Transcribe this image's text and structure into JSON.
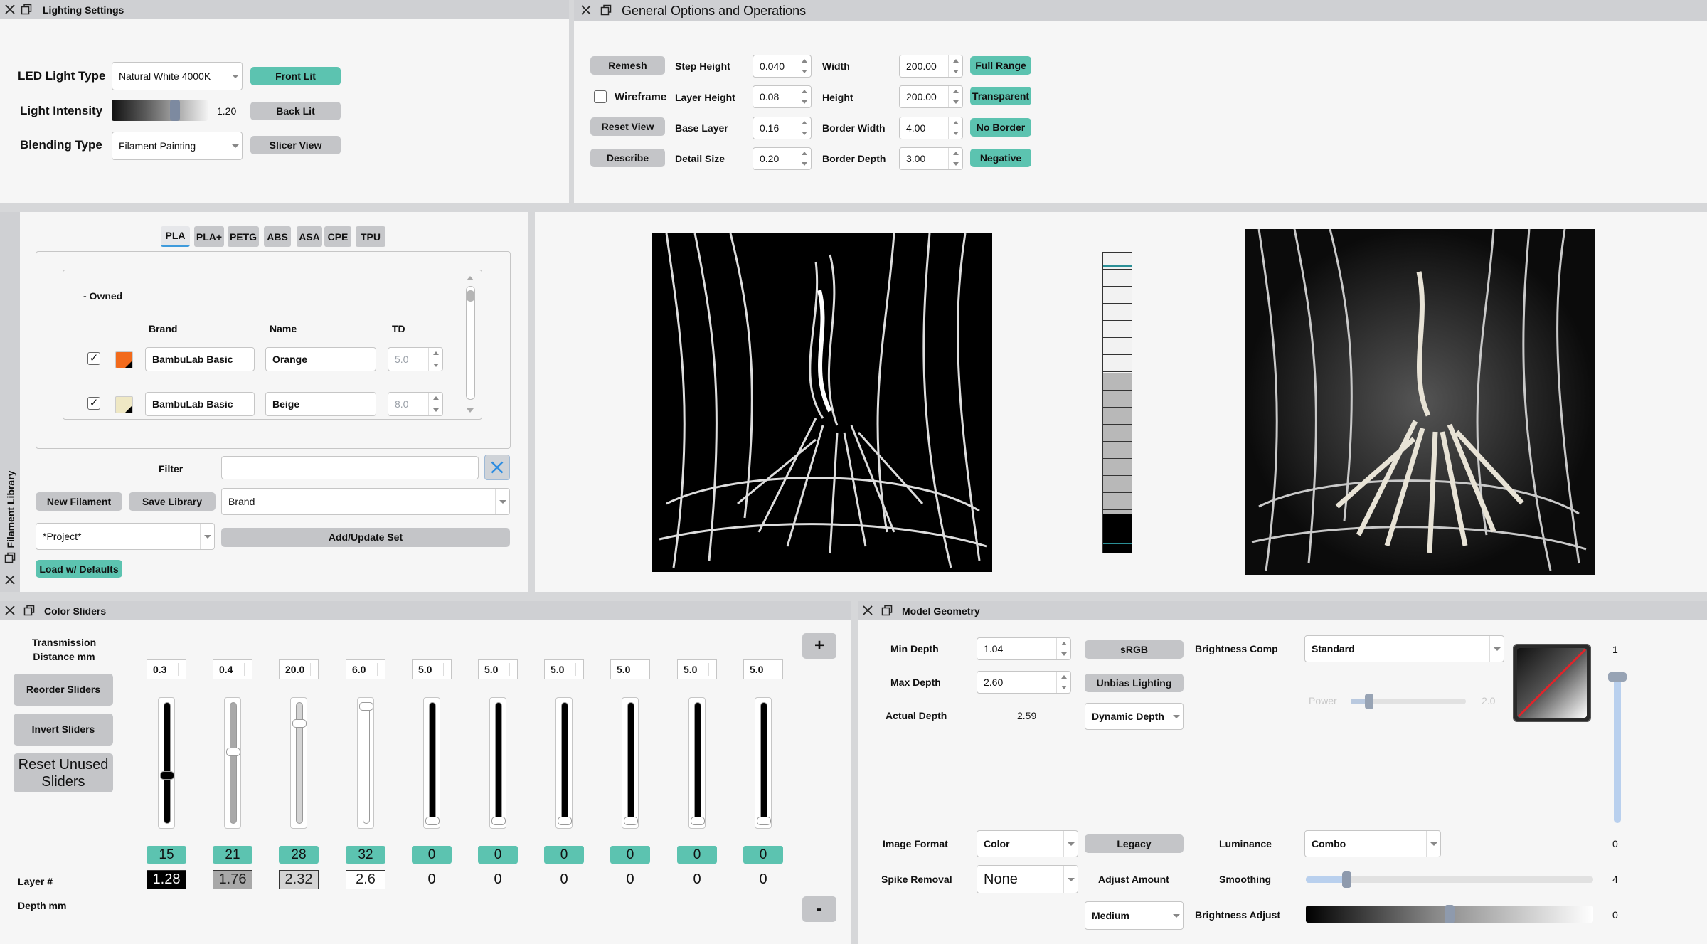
{
  "lighting": {
    "title": "Lighting Settings",
    "led_label": "LED Light Type",
    "led_value": "Natural White 4000K",
    "intensity_label": "Light Intensity",
    "intensity_value": "1.20",
    "blend_label": "Blending Type",
    "blend_value": "Filament Painting",
    "front_lit": "Front Lit",
    "back_lit": "Back Lit",
    "slicer_view": "Slicer View"
  },
  "general": {
    "title": "General Options and Operations",
    "remesh": "Remesh",
    "wireframe": "Wireframe",
    "reset_view": "Reset View",
    "describe": "Describe",
    "step_height_label": "Step Height",
    "step_height": "0.040",
    "layer_height_label": "Layer Height",
    "layer_height": "0.08",
    "base_layer_label": "Base Layer",
    "base_layer": "0.16",
    "detail_size_label": "Detail Size",
    "detail_size": "0.20",
    "width_label": "Width",
    "width": "200.00",
    "height_label": "Height",
    "height": "200.00",
    "border_width_label": "Border Width",
    "border_width": "4.00",
    "border_depth_label": "Border Depth",
    "border_depth": "3.00",
    "full_range": "Full Range",
    "transparent": "Transparent",
    "no_border": "No Border",
    "negative": "Negative"
  },
  "library": {
    "title": "Filament Library",
    "tabs": [
      "PLA",
      "PLA+",
      "PETG",
      "ABS",
      "ASA",
      "CPE",
      "TPU"
    ],
    "group": "- Owned",
    "col_brand": "Brand",
    "col_name": "Name",
    "col_td": "TD",
    "rows": [
      {
        "brand": "BambuLab Basic",
        "name": "Orange",
        "td": "5.0",
        "color": "#f26a1b"
      },
      {
        "brand": "BambuLab Basic",
        "name": "Beige",
        "td": "8.0",
        "color": "#efe8c4"
      }
    ],
    "filter_label": "Filter",
    "filter_value": "",
    "new_filament": "New Filament",
    "save_library": "Save Library",
    "sort_value": "Brand",
    "project_value": "*Project*",
    "add_update": "Add/Update Set",
    "load_defaults": "Load w/ Defaults"
  },
  "color_sliders": {
    "title": "Color Sliders",
    "transmission_label": "Transmission Distance mm",
    "reorder": "Reorder Sliders",
    "invert": "Invert Sliders",
    "reset_unused": "Reset Unused Sliders",
    "layer_label": "Layer #",
    "depth_label": "Depth mm",
    "plus": "+",
    "minus": "-",
    "sliders": [
      {
        "td": "0.3",
        "layer": "15",
        "depth": "1.28",
        "level": 0.4,
        "color": "#000000"
      },
      {
        "td": "0.4",
        "layer": "21",
        "depth": "1.76",
        "level": 0.6,
        "color": "#a8a8a8"
      },
      {
        "td": "20.0",
        "layer": "28",
        "depth": "2.32",
        "level": 0.85,
        "color": "#d4d4d4"
      },
      {
        "td": "6.0",
        "layer": "32",
        "depth": "2.6",
        "level": 1.0,
        "color": "#ffffff"
      },
      {
        "td": "5.0",
        "layer": "0",
        "depth": "0",
        "level": 0,
        "color": "#000000"
      },
      {
        "td": "5.0",
        "layer": "0",
        "depth": "0",
        "level": 0,
        "color": "#000000"
      },
      {
        "td": "5.0",
        "layer": "0",
        "depth": "0",
        "level": 0,
        "color": "#000000"
      },
      {
        "td": "5.0",
        "layer": "0",
        "depth": "0",
        "level": 0,
        "color": "#000000"
      },
      {
        "td": "5.0",
        "layer": "0",
        "depth": "0",
        "level": 0,
        "color": "#000000"
      },
      {
        "td": "5.0",
        "layer": "0",
        "depth": "0",
        "level": 0,
        "color": "#000000"
      }
    ]
  },
  "geometry": {
    "title": "Model Geometry",
    "min_depth_label": "Min Depth",
    "min_depth": "1.04",
    "max_depth_label": "Max Depth",
    "max_depth": "2.60",
    "actual_depth_label": "Actual Depth",
    "actual_depth": "2.59",
    "srgb": "sRGB",
    "unbias": "Unbias Lighting",
    "dynamic_depth": "Dynamic Depth",
    "brightness_comp_label": "Brightness Comp",
    "brightness_comp": "Standard",
    "power_label": "Power",
    "power_value": "2.0",
    "vertical_top": "1",
    "vertical_bottom": "0",
    "image_format_label": "Image Format",
    "image_format": "Color",
    "legacy": "Legacy",
    "luminance_label": "Luminance",
    "luminance": "Combo",
    "spike_label": "Spike Removal",
    "spike": "None",
    "adjust_label": "Adjust Amount",
    "adjust": "Medium",
    "smoothing_label": "Smoothing",
    "smoothing_value": "4",
    "smoothing_level": 0.14,
    "brightness_label": "Brightness Adjust",
    "brightness_value": "0",
    "brightness_level": 0.5
  },
  "colors": {
    "accent": "#5cc3b0",
    "panel": "#f6f6f6",
    "header": "#cfd0d3",
    "button": "#c4c5c8"
  }
}
